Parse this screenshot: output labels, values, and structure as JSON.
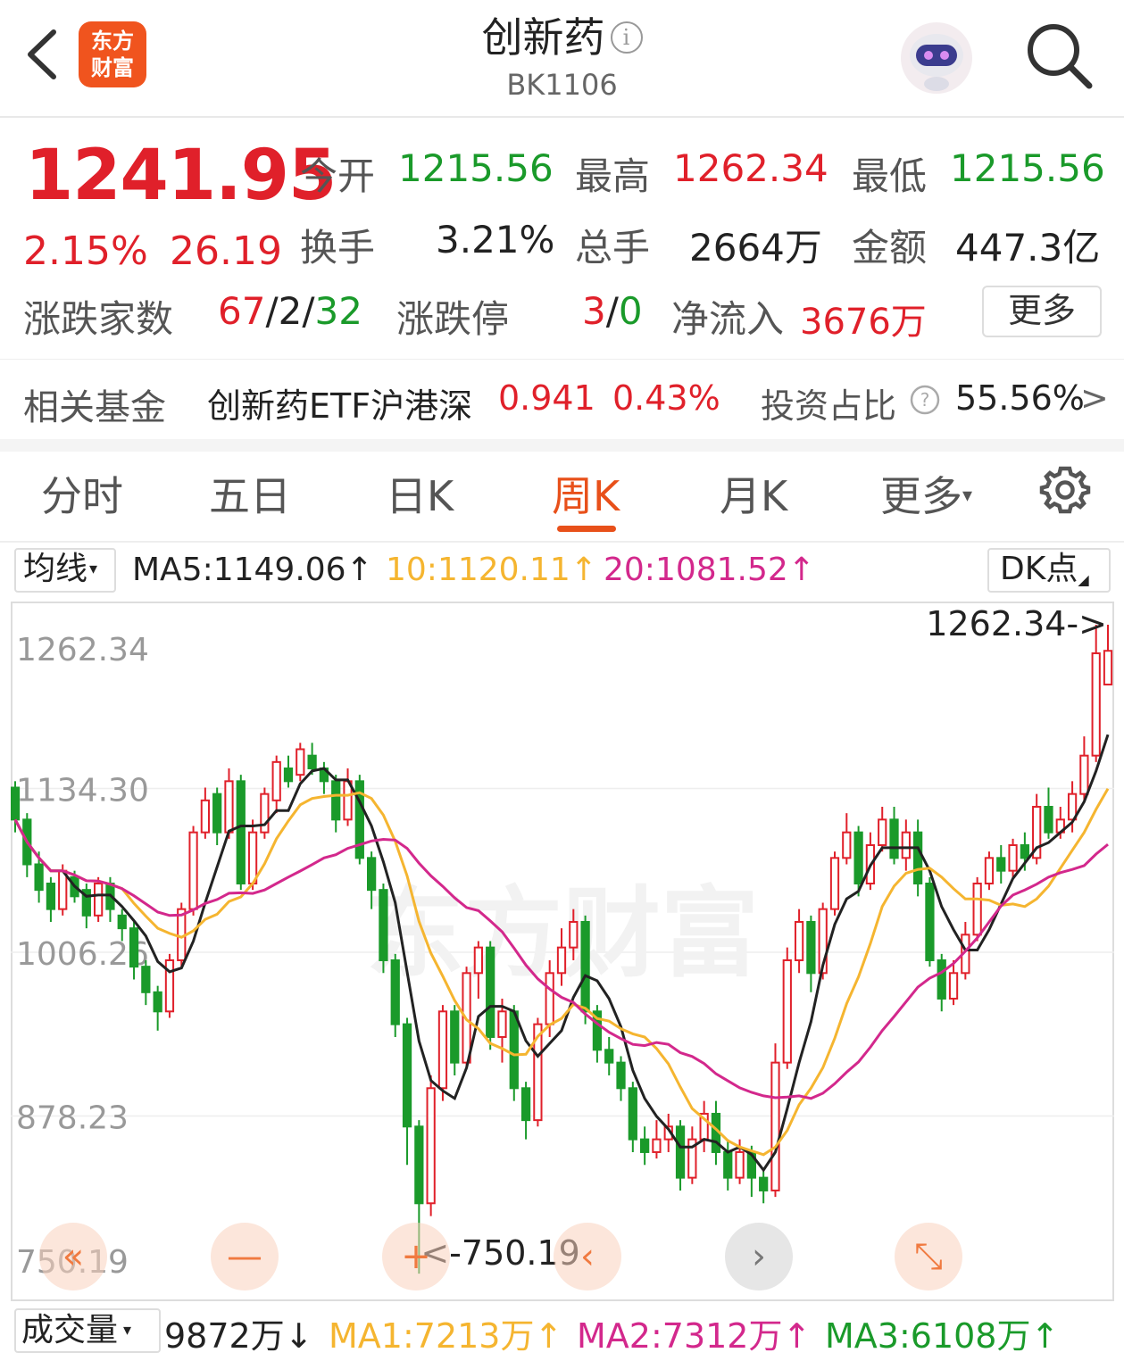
{
  "header": {
    "title": "创新药",
    "info_icon": "i",
    "code": "BK1106",
    "logo_line1": "东方",
    "logo_line2": "财富"
  },
  "quote": {
    "price": "1241.95",
    "change_pct": "2.15%",
    "change": "26.19",
    "open_label": "今开",
    "open": "1215.56",
    "high_label": "最高",
    "high": "1262.34",
    "low_label": "最低",
    "low": "1215.56",
    "turnover_label": "换手",
    "turnover": "3.21%",
    "volume_label": "总手",
    "volume": "2664万",
    "amount_label": "金额",
    "amount": "447.3亿",
    "breadth_label": "涨跌家数",
    "breadth_up": "67",
    "breadth_sep1": "/",
    "breadth_flat": "2",
    "breadth_sep2": "/",
    "breadth_down": "32",
    "limit_label": "涨跌停",
    "limit_up": "3",
    "limit_sep": "/",
    "limit_down": "0",
    "inflow_label": "净流入",
    "inflow": "3676万",
    "more_label": "更多"
  },
  "fund": {
    "label": "相关基金",
    "name": "创新药ETF沪港深",
    "price": "0.941",
    "pct": "0.43%",
    "ratio_label": "投资占比",
    "ratio": "55.56%",
    "arrow": ">"
  },
  "tabs": [
    "分时",
    "五日",
    "日K",
    "周K",
    "月K",
    "更多"
  ],
  "ma_line": {
    "select_label": "均线",
    "ma5": "MA5:1149.06↑",
    "ma10": "10:1120.11↑",
    "ma20": "20:1081.52↑",
    "dk_label": "DK点"
  },
  "volume_line": {
    "select_label": "成交量",
    "vol": "9872万↓",
    "ma1": "MA1:7213万↑",
    "ma2": "MA2:7312万↑",
    "ma3": "MA3:6108万↑"
  },
  "chart_buttons": [
    "«",
    "—",
    "+",
    "‹",
    "›",
    "⤡"
  ],
  "colors": {
    "up": "#e0202a",
    "down": "#1a9a2a",
    "ma5": "#222222",
    "ma10": "#f5b530",
    "ma20": "#d3288c",
    "accent": "#e8501a"
  },
  "chart_data": {
    "type": "candlestick",
    "y_ticks": [
      "1262.34",
      "1134.30",
      "1006.26",
      "878.23",
      "750.19"
    ],
    "ylim": [
      750.19,
      1262.34
    ],
    "max_label": "1262.34->",
    "min_label": "<-750.19",
    "watermark": "东方财富",
    "candles": [
      [
        1135,
        1110,
        1140,
        1100
      ],
      [
        1110,
        1075,
        1115,
        1065
      ],
      [
        1075,
        1055,
        1085,
        1045
      ],
      [
        1060,
        1040,
        1065,
        1030
      ],
      [
        1040,
        1070,
        1075,
        1035
      ],
      [
        1065,
        1050,
        1070,
        1045
      ],
      [
        1055,
        1035,
        1060,
        1025
      ],
      [
        1035,
        1060,
        1065,
        1030
      ],
      [
        1060,
        1040,
        1065,
        1030
      ],
      [
        1035,
        1025,
        1040,
        1015
      ],
      [
        1025,
        995,
        1030,
        985
      ],
      [
        995,
        975,
        1000,
        965
      ],
      [
        975,
        960,
        980,
        945
      ],
      [
        960,
        1000,
        1005,
        955
      ],
      [
        1000,
        1040,
        1045,
        995
      ],
      [
        1040,
        1100,
        1105,
        1035
      ],
      [
        1100,
        1125,
        1135,
        1095
      ],
      [
        1130,
        1100,
        1135,
        1090
      ],
      [
        1100,
        1140,
        1150,
        1095
      ],
      [
        1140,
        1060,
        1145,
        1055
      ],
      [
        1060,
        1100,
        1110,
        1055
      ],
      [
        1100,
        1130,
        1135,
        1095
      ],
      [
        1125,
        1155,
        1160,
        1115
      ],
      [
        1150,
        1140,
        1160,
        1135
      ],
      [
        1145,
        1165,
        1170,
        1140
      ],
      [
        1160,
        1150,
        1170,
        1145
      ],
      [
        1150,
        1140,
        1155,
        1130
      ],
      [
        1140,
        1110,
        1145,
        1100
      ],
      [
        1110,
        1140,
        1150,
        1105
      ],
      [
        1140,
        1080,
        1145,
        1075
      ],
      [
        1080,
        1055,
        1085,
        1040
      ],
      [
        1055,
        1000,
        1060,
        990
      ],
      [
        1000,
        950,
        1005,
        940
      ],
      [
        950,
        870,
        955,
        840
      ],
      [
        870,
        810,
        875,
        755
      ],
      [
        810,
        900,
        910,
        800
      ],
      [
        900,
        960,
        965,
        890
      ],
      [
        960,
        920,
        965,
        910
      ],
      [
        920,
        990,
        995,
        915
      ],
      [
        990,
        1010,
        1015,
        970
      ],
      [
        1010,
        940,
        1015,
        930
      ],
      [
        940,
        960,
        970,
        920
      ],
      [
        960,
        900,
        965,
        890
      ],
      [
        900,
        875,
        905,
        860
      ],
      [
        875,
        950,
        955,
        870
      ],
      [
        950,
        990,
        1000,
        940
      ],
      [
        990,
        1010,
        1025,
        980
      ],
      [
        1010,
        1030,
        1040,
        1000
      ],
      [
        1030,
        960,
        1035,
        950
      ],
      [
        960,
        930,
        965,
        920
      ],
      [
        930,
        920,
        940,
        910
      ],
      [
        920,
        900,
        925,
        890
      ],
      [
        900,
        860,
        905,
        850
      ],
      [
        860,
        850,
        870,
        840
      ],
      [
        850,
        860,
        875,
        845
      ],
      [
        860,
        870,
        880,
        850
      ],
      [
        870,
        830,
        875,
        820
      ],
      [
        830,
        860,
        870,
        825
      ],
      [
        860,
        880,
        890,
        850
      ],
      [
        880,
        850,
        890,
        840
      ],
      [
        850,
        830,
        860,
        820
      ],
      [
        830,
        850,
        860,
        825
      ],
      [
        850,
        830,
        855,
        815
      ],
      [
        830,
        820,
        835,
        810
      ],
      [
        820,
        920,
        935,
        815
      ],
      [
        920,
        1000,
        1010,
        915
      ],
      [
        1000,
        1030,
        1040,
        990
      ],
      [
        1030,
        990,
        1035,
        975
      ],
      [
        990,
        1040,
        1045,
        985
      ],
      [
        1040,
        1080,
        1085,
        1035
      ],
      [
        1080,
        1100,
        1115,
        1075
      ],
      [
        1100,
        1060,
        1105,
        1050
      ],
      [
        1060,
        1090,
        1100,
        1055
      ],
      [
        1090,
        1110,
        1120,
        1085
      ],
      [
        1110,
        1080,
        1120,
        1075
      ],
      [
        1080,
        1100,
        1110,
        1070
      ],
      [
        1100,
        1060,
        1110,
        1050
      ],
      [
        1060,
        1000,
        1065,
        995
      ],
      [
        1000,
        970,
        1005,
        960
      ],
      [
        970,
        990,
        1000,
        965
      ],
      [
        990,
        1020,
        1030,
        985
      ],
      [
        1020,
        1060,
        1065,
        1015
      ],
      [
        1060,
        1080,
        1085,
        1055
      ],
      [
        1080,
        1070,
        1090,
        1060
      ],
      [
        1070,
        1090,
        1095,
        1065
      ],
      [
        1090,
        1080,
        1100,
        1070
      ],
      [
        1080,
        1120,
        1130,
        1075
      ],
      [
        1120,
        1100,
        1135,
        1095
      ],
      [
        1100,
        1110,
        1120,
        1095
      ],
      [
        1110,
        1130,
        1140,
        1100
      ],
      [
        1130,
        1160,
        1175,
        1125
      ],
      [
        1160,
        1240,
        1262.34,
        1155
      ],
      [
        1215.56,
        1241.95,
        1262.34,
        1215.56
      ]
    ]
  }
}
